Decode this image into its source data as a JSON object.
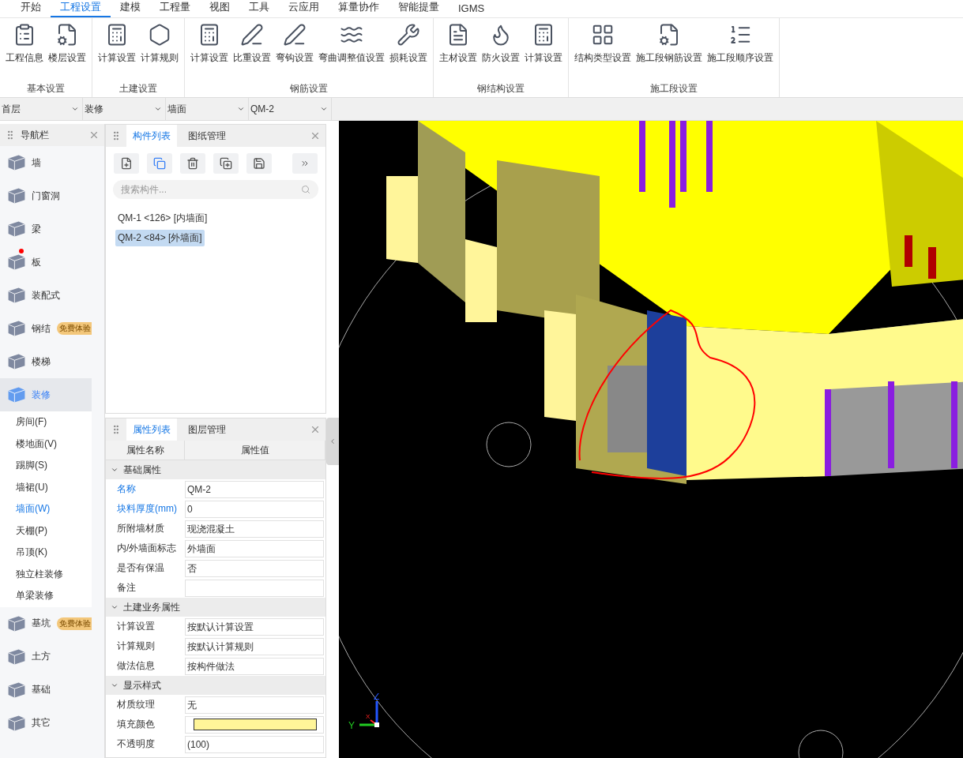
{
  "menu": [
    {
      "label": "开始",
      "selected": false
    },
    {
      "label": "工程设置",
      "selected": true
    },
    {
      "label": "建模",
      "selected": false
    },
    {
      "label": "工程量",
      "selected": false
    },
    {
      "label": "视图",
      "selected": false
    },
    {
      "label": "工具",
      "selected": false
    },
    {
      "label": "云应用",
      "selected": false
    },
    {
      "label": "算量协作",
      "selected": false
    },
    {
      "label": "智能提量",
      "selected": false
    },
    {
      "label": "IGMS",
      "selected": false
    }
  ],
  "ribbon": [
    {
      "title": "基本设置",
      "buttons": [
        "工程信息",
        "楼层设置"
      ]
    },
    {
      "title": "土建设置",
      "buttons": [
        "计算设置",
        "计算规则"
      ]
    },
    {
      "title": "钢筋设置",
      "buttons": [
        "计算设置",
        "比重设置",
        "弯钩设置",
        "弯曲调整值设置",
        "损耗设置"
      ]
    },
    {
      "title": "钢结构设置",
      "buttons": [
        "主材设置",
        "防火设置",
        "计算设置"
      ]
    },
    {
      "title": "施工段设置",
      "buttons": [
        "结构类型设置",
        "施工段钢筋设置",
        "施工段顺序设置"
      ]
    }
  ],
  "selectors": [
    "首层",
    "装修",
    "墙面",
    "QM-2"
  ],
  "nav": {
    "title": "导航栏",
    "items": [
      {
        "label": "墙",
        "selected": false
      },
      {
        "label": "门窗洞",
        "selected": false
      },
      {
        "label": "梁",
        "selected": false
      },
      {
        "label": "板",
        "selected": false,
        "dot": true
      },
      {
        "label": "装配式",
        "selected": false
      },
      {
        "label": "钢结",
        "selected": false,
        "badge": "免费体验"
      },
      {
        "label": "楼梯",
        "selected": false
      },
      {
        "label": "装修",
        "selected": true,
        "children": [
          {
            "label": "房间(F)",
            "selected": false
          },
          {
            "label": "楼地面(V)",
            "selected": false
          },
          {
            "label": "踢脚(S)",
            "selected": false
          },
          {
            "label": "墙裙(U)",
            "selected": false
          },
          {
            "label": "墙面(W)",
            "selected": true
          },
          {
            "label": "天棚(P)",
            "selected": false
          },
          {
            "label": "吊顶(K)",
            "selected": false
          },
          {
            "label": "独立柱装修",
            "selected": false
          },
          {
            "label": "单梁装修",
            "selected": false
          }
        ]
      },
      {
        "label": "基坑",
        "selected": false,
        "badge": "免费体验"
      },
      {
        "label": "土方",
        "selected": false
      },
      {
        "label": "基础",
        "selected": false
      },
      {
        "label": "其它",
        "selected": false
      }
    ]
  },
  "component_panel": {
    "tabs": [
      {
        "label": "构件列表",
        "selected": true
      },
      {
        "label": "图纸管理",
        "selected": false
      }
    ],
    "search": {
      "placeholder": "搜索构件..."
    },
    "items": [
      {
        "label": "QM-1 <126> [内墙面]",
        "selected": false
      },
      {
        "label": "QM-2 <84> [外墙面]",
        "selected": true
      }
    ]
  },
  "property_panel": {
    "tabs": [
      {
        "label": "属性列表",
        "selected": true
      },
      {
        "label": "图层管理",
        "selected": false
      }
    ],
    "columns": [
      "属性名称",
      "属性值"
    ],
    "groups": [
      {
        "title": "基础属性",
        "expanded": true,
        "rows": [
          {
            "name": "名称",
            "value": "QM-2",
            "emphasized": true
          },
          {
            "name": "块料厚度(mm)",
            "value": "0",
            "emphasized": true
          },
          {
            "name": "所附墙材质",
            "value": "现浇混凝土",
            "emphasized": false
          },
          {
            "name": "内/外墙面标志",
            "value": "外墙面",
            "emphasized": false
          },
          {
            "name": "是否有保温",
            "value": "否",
            "emphasized": false
          },
          {
            "name": "备注",
            "emphasized": false
          }
        ]
      },
      {
        "title": "土建业务属性",
        "expanded": true,
        "rows": [
          {
            "name": "计算设置",
            "value": "按默认计算设置",
            "emphasized": false
          },
          {
            "name": "计算规则",
            "value": "按默认计算规则",
            "emphasized": false
          },
          {
            "name": "做法信息",
            "value": "按构件做法",
            "emphasized": false
          }
        ]
      },
      {
        "title": "显示样式",
        "expanded": true,
        "rows": [
          {
            "name": "材质纹理",
            "value": "无",
            "emphasized": false
          },
          {
            "name": "填充颜色",
            "color": "#fff599",
            "emphasized": false
          },
          {
            "name": "不透明度",
            "value": "(100)",
            "emphasized": false
          }
        ]
      }
    ]
  },
  "viewport": {
    "axes": [
      "Z",
      "Y",
      "X"
    ]
  }
}
